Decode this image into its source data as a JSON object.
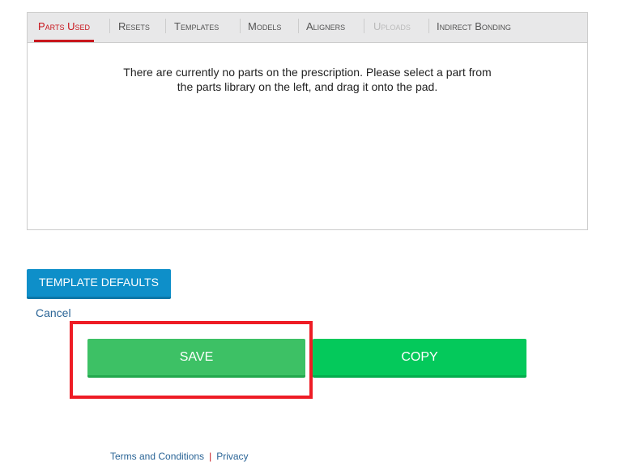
{
  "tabs": [
    {
      "label": "Parts Used",
      "state": "active"
    },
    {
      "label": "Resets",
      "state": "normal"
    },
    {
      "label": "Templates",
      "state": "normal"
    },
    {
      "label": "Models",
      "state": "normal"
    },
    {
      "label": "Aligners",
      "state": "normal"
    },
    {
      "label": "Uploads",
      "state": "disabled"
    },
    {
      "label": "Indirect Bonding",
      "state": "normal"
    }
  ],
  "panel": {
    "message_line1": "There are currently no parts on the prescription. Please select a part from",
    "message_line2": "the parts library on the left, and drag it onto the pad."
  },
  "actions": {
    "template_defaults": "TEMPLATE DEFAULTS",
    "cancel": "Cancel",
    "save": "SAVE",
    "copy": "COPY"
  },
  "footer": {
    "terms": "Terms and Conditions",
    "separator": "|",
    "privacy": "Privacy"
  },
  "colors": {
    "accent_red": "#c8161d",
    "blue": "#0e8fc9",
    "save_green": "#3dc165",
    "copy_green": "#04c95b",
    "highlight": "#ee1c25"
  }
}
